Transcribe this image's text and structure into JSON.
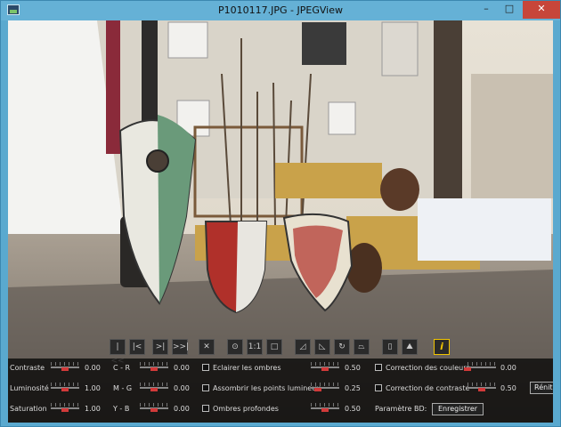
{
  "window": {
    "title": "P1010117.JPG - JPEGView",
    "minimize": "–",
    "maximize": "□",
    "close": "✕"
  },
  "toolbar": {
    "buttons": [
      {
        "name": "first-image-button",
        "icon": "|<<"
      },
      {
        "name": "prev-image-button",
        "icon": "|<"
      },
      {
        "name": "next-image-button",
        "icon": ">|"
      },
      {
        "name": "last-image-button",
        "icon": ">>|"
      },
      {
        "name": "delete-button",
        "icon": "✕"
      },
      {
        "name": "zoom-fit-button",
        "icon": "⊙"
      },
      {
        "name": "actual-size-button",
        "icon": "1:1"
      },
      {
        "name": "fullscreen-button",
        "icon": "□"
      },
      {
        "name": "rotate-left-perspective-button",
        "icon": "◿"
      },
      {
        "name": "rotate-right-perspective-button",
        "icon": "◺"
      },
      {
        "name": "rotate-button",
        "icon": "↻"
      },
      {
        "name": "perspective-button",
        "icon": "⏢"
      },
      {
        "name": "crop-button",
        "icon": "▯"
      },
      {
        "name": "landscape-button",
        "icon": "⛰"
      },
      {
        "name": "info-button",
        "icon": "i"
      }
    ]
  },
  "panel": {
    "contrast": {
      "label": "Contraste",
      "value": "0.00",
      "level": 0.5
    },
    "brightness": {
      "label": "Luminosité",
      "value": "1.00",
      "level": 0.5
    },
    "saturation": {
      "label": "Saturation",
      "value": "1.00",
      "level": 0.5
    },
    "cr": {
      "label": "C - R",
      "value": "0.00",
      "level": 0.5
    },
    "mg": {
      "label": "M - G",
      "value": "0.00",
      "level": 0.5
    },
    "yb": {
      "label": "Y - B",
      "value": "0.00",
      "level": 0.5
    },
    "shadows": {
      "label": "Eclairer les ombres",
      "value": "0.50",
      "level": 0.5
    },
    "highlights": {
      "label": "Assombrir les points lumineux",
      "value": "0.25",
      "level": 0.25
    },
    "deep_shadows": {
      "label": "Ombres profondes",
      "value": "0.50",
      "level": 0.5
    },
    "color_correction": {
      "label": "Correction des couleurs",
      "value": "0.00",
      "level": 0.0
    },
    "contrast_correction": {
      "label": "Correction de contraste",
      "value": "0.50",
      "level": 0.5
    },
    "param_bd": {
      "label": "Paramètre BD:"
    },
    "save_button": "Enregistrer",
    "reset_button": "Rénito"
  }
}
